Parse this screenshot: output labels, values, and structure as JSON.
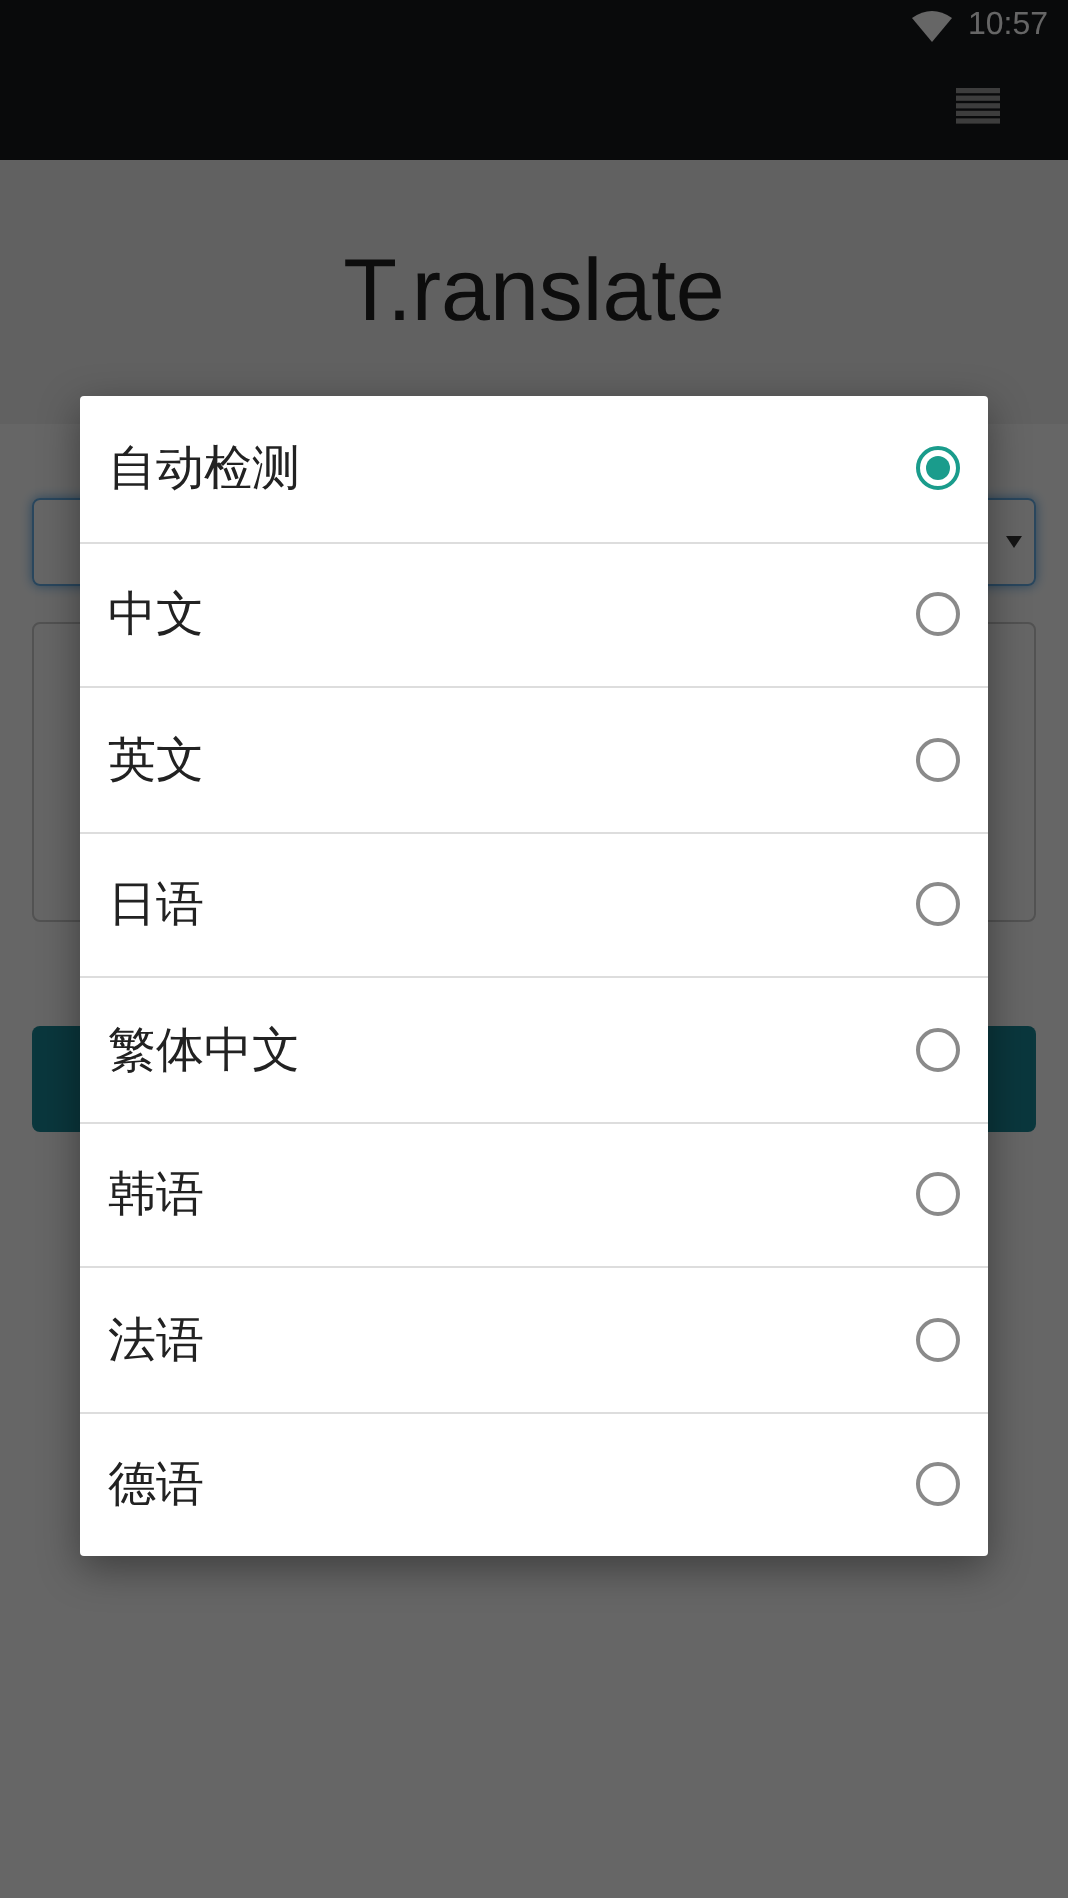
{
  "status_bar": {
    "time": "10:57"
  },
  "header": {
    "title": "T.ranslate"
  },
  "language_dialog": {
    "options": [
      {
        "label": "自动检测",
        "selected": true
      },
      {
        "label": "中文",
        "selected": false
      },
      {
        "label": "英文",
        "selected": false
      },
      {
        "label": "日语",
        "selected": false
      },
      {
        "label": "繁体中文",
        "selected": false
      },
      {
        "label": "韩语",
        "selected": false
      },
      {
        "label": "法语",
        "selected": false
      },
      {
        "label": "德语",
        "selected": false
      }
    ]
  }
}
